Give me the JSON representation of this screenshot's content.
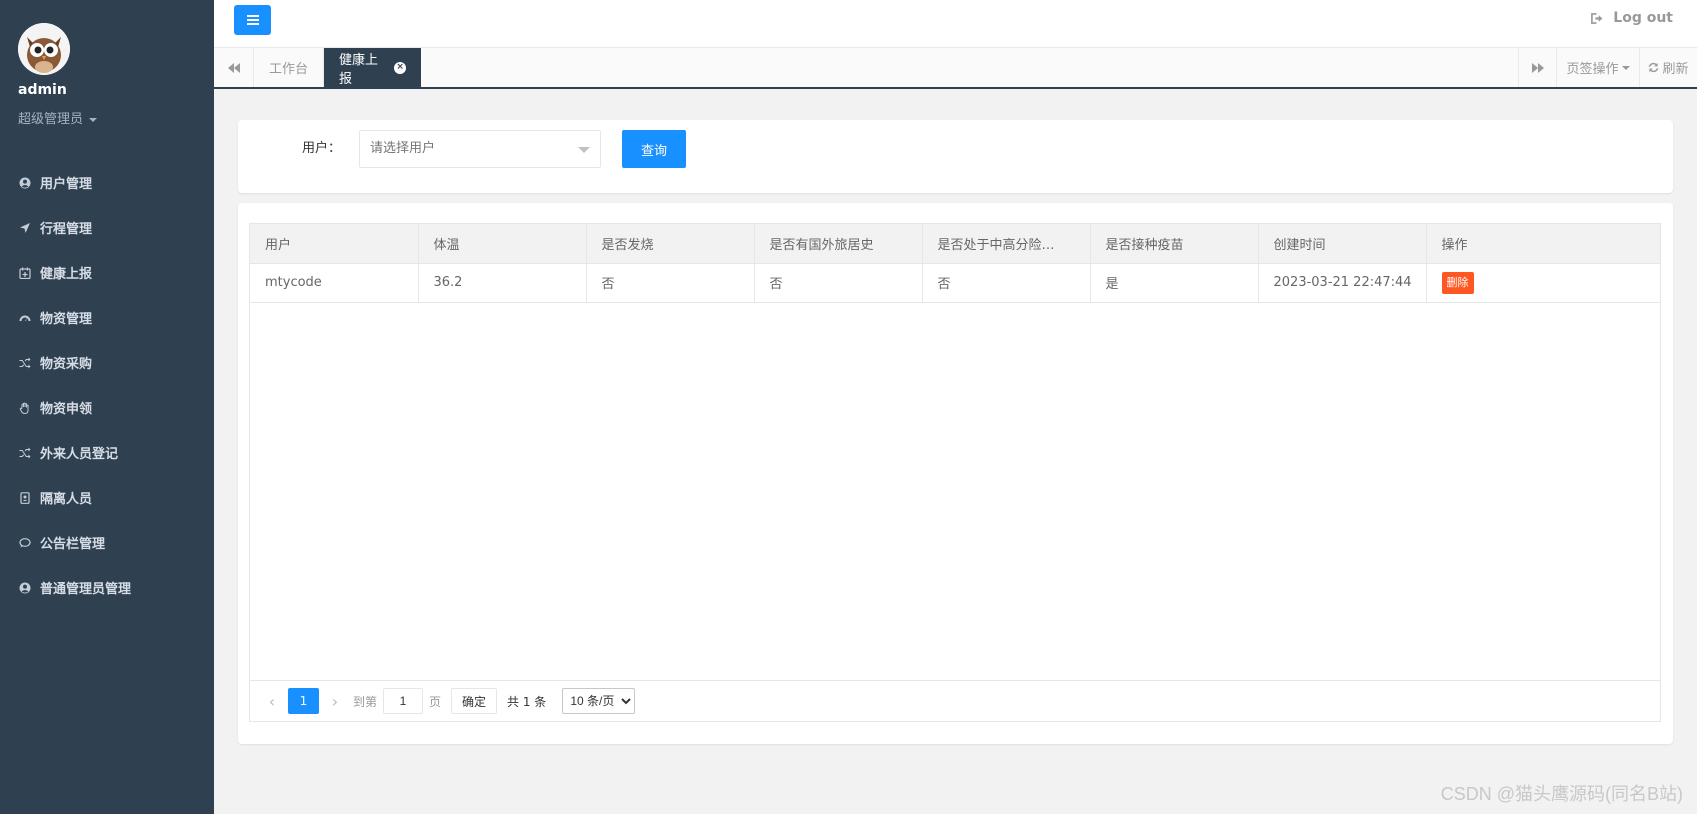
{
  "sidebar": {
    "user_name": "admin",
    "user_role": "超级管理员",
    "items": [
      {
        "label": "用户管理",
        "icon": "user-circle-icon"
      },
      {
        "label": "行程管理",
        "icon": "location-arrow-icon"
      },
      {
        "label": "健康上报",
        "icon": "calendar-plus-icon"
      },
      {
        "label": "物资管理",
        "icon": "dashboard-icon"
      },
      {
        "label": "物资采购",
        "icon": "random-icon"
      },
      {
        "label": "物资申领",
        "icon": "hand-icon"
      },
      {
        "label": "外来人员登记",
        "icon": "random-icon"
      },
      {
        "label": "隔离人员",
        "icon": "id-badge-icon"
      },
      {
        "label": "公告栏管理",
        "icon": "comment-icon"
      },
      {
        "label": "普通管理员管理",
        "icon": "user-circle-icon"
      }
    ]
  },
  "header": {
    "logout_label": "Log out"
  },
  "tabs": {
    "items": [
      {
        "label": "工作台"
      },
      {
        "label": "健康上报"
      }
    ],
    "page_ops_label": "页签操作",
    "refresh_label": "刷新"
  },
  "search": {
    "user_label": "用户：",
    "user_placeholder": "请选择用户",
    "query_label": "查询"
  },
  "table": {
    "columns": [
      "用户",
      "体温",
      "是否发烧",
      "是否有国外旅居史",
      "是否处于中高分险…",
      "是否接种疫苗",
      "创建时间",
      "操作"
    ],
    "rows": [
      {
        "user": "mtycode",
        "temp": "36.2",
        "fever": "否",
        "abroad": "否",
        "risk": "否",
        "vaccine": "是",
        "created": "2023-03-21 22:47:44",
        "action": "删除"
      }
    ]
  },
  "pager": {
    "current_page": "1",
    "goto_label": "到第",
    "goto_value": "1",
    "page_unit": "页",
    "confirm_label": "确定",
    "total_label": "共 1 条",
    "page_size_label": "10 条/页"
  },
  "watermark": "CSDN @猫头鹰源码(同名B站)",
  "colors": {
    "sidebar_bg": "#2f4050",
    "primary": "#1890ff",
    "danger": "#ff5722"
  }
}
